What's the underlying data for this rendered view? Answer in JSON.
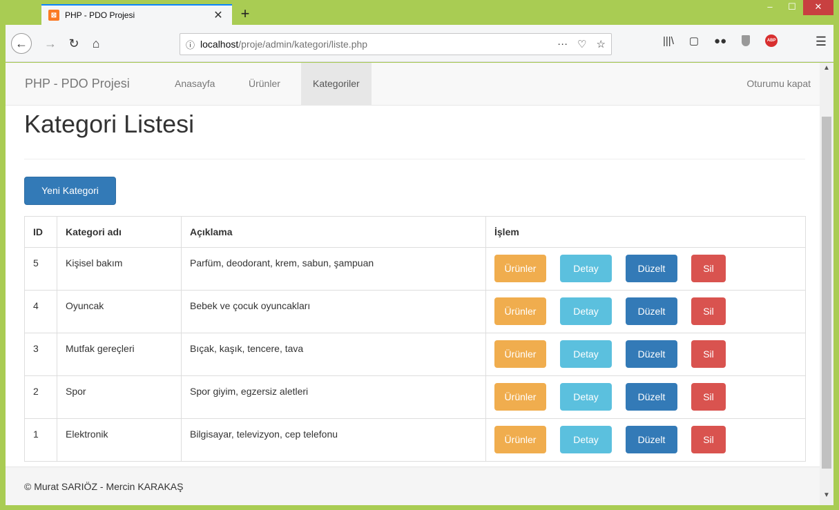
{
  "browser": {
    "tab_title": "PHP - PDO Projesi",
    "tab_favicon": "xampp-favicon",
    "new_tab": "+",
    "url_info": "ⓘ",
    "url_host": "localhost",
    "url_path": "/proje/admin/kategori/liste.php",
    "url_more": "···",
    "window_controls": [
      "minimize",
      "maximize",
      "close"
    ]
  },
  "navbar": {
    "brand": "PHP - PDO Projesi",
    "items": [
      {
        "label": "Anasayfa",
        "active": false
      },
      {
        "label": "Ürünler",
        "active": false
      },
      {
        "label": "Kategoriler",
        "active": true
      }
    ],
    "logout": "Oturumu kapat"
  },
  "page": {
    "title": "Kategori Listesi",
    "new_button": "Yeni Kategori"
  },
  "table": {
    "headers": [
      "ID",
      "Kategori adı",
      "Açıklama",
      "İşlem"
    ],
    "rows": [
      {
        "id": "5",
        "name": "Kişisel bakım",
        "desc": "Parfüm, deodorant, krem, sabun, şampuan"
      },
      {
        "id": "4",
        "name": "Oyuncak",
        "desc": "Bebek ve çocuk oyuncakları"
      },
      {
        "id": "3",
        "name": "Mutfak gereçleri",
        "desc": "Bıçak, kaşık, tencere, tava"
      },
      {
        "id": "2",
        "name": "Spor",
        "desc": "Spor giyim, egzersiz aletleri"
      },
      {
        "id": "1",
        "name": "Elektronik",
        "desc": "Bilgisayar, televizyon, cep telefonu"
      }
    ],
    "actions": {
      "urunler": "Ürünler",
      "detay": "Detay",
      "duzelt": "Düzelt",
      "sil": "Sil"
    }
  },
  "footer": {
    "text": "© Murat SARIÖZ - Mercin KARAKAŞ"
  },
  "colors": {
    "primary": "#337ab7",
    "warning": "#f0ad4e",
    "info": "#5bc0de",
    "danger": "#d9534f"
  }
}
